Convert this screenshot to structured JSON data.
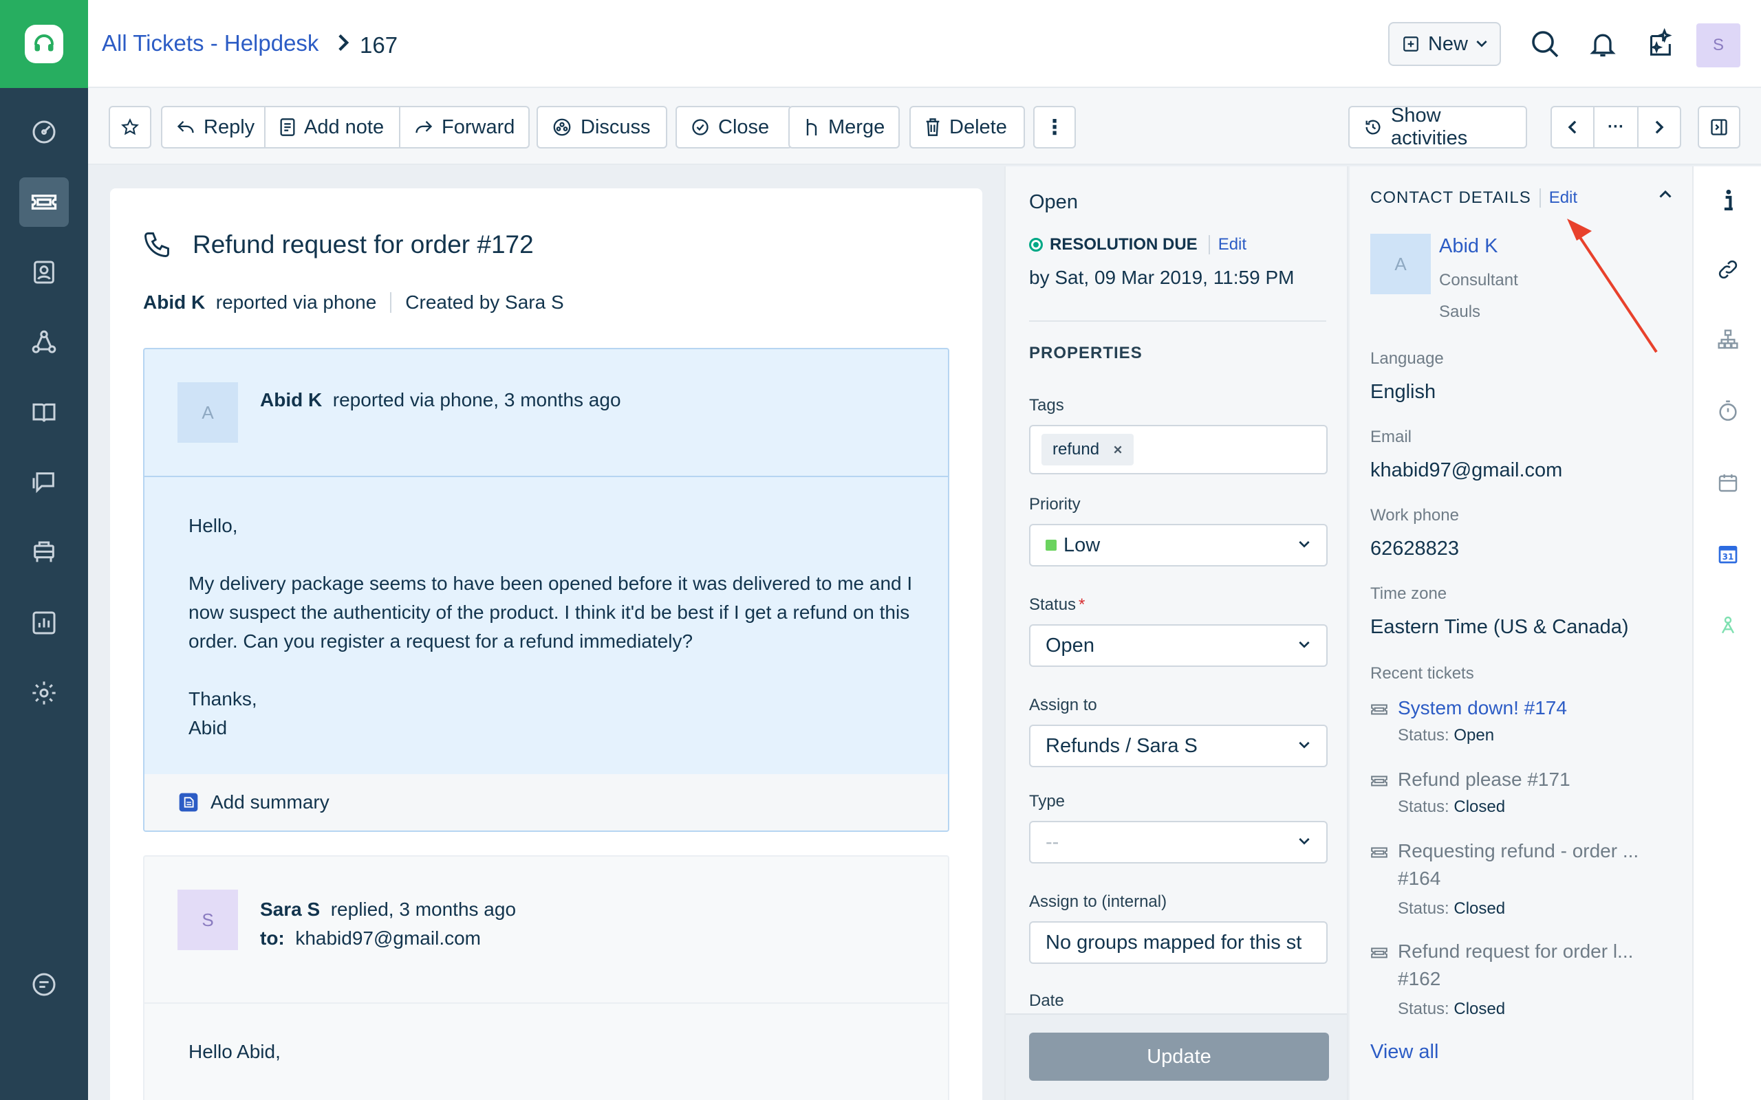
{
  "header": {
    "breadcrumb_link": "All Tickets - Helpdesk",
    "ticket_id": "167",
    "new_label": "New",
    "avatar_initial": "S"
  },
  "toolbar": {
    "reply": "Reply",
    "add_note": "Add note",
    "forward": "Forward",
    "discuss": "Discuss",
    "close": "Close",
    "merge": "Merge",
    "delete": "Delete",
    "show_activities": "Show activities",
    "more": "⋮",
    "pager_more": "···"
  },
  "ticket": {
    "title": "Refund request for order #172",
    "reporter": "Abid K",
    "reported_via": "reported via phone",
    "created_by": "Created by Sara S",
    "messages": [
      {
        "avatar": "A",
        "author": "Abid K",
        "meta": "reported via phone, 3 months ago",
        "greeting": "Hello,",
        "body": "My delivery package seems to have been opened before it was delivered to me and I now suspect the authenticity of the product. I think it'd be best if I get a refund on this order. Can you register a request for a refund immediately?",
        "signoff": "Thanks,",
        "signature": "Abid",
        "summary_label": "Add summary"
      },
      {
        "avatar": "S",
        "author": "Sara S",
        "meta": "replied, 3 months ago",
        "to_label": "to:",
        "to_value": "khabid97@gmail.com",
        "body": "Hello Abid,"
      }
    ]
  },
  "properties": {
    "status_text": "Open",
    "resolution_label": "RESOLUTION DUE",
    "resolution_edit": "Edit",
    "resolution_date": "by Sat, 09 Mar 2019, 11:59 PM",
    "heading": "PROPERTIES",
    "tags_label": "Tags",
    "tags": [
      "refund"
    ],
    "priority_label": "Priority",
    "priority_value": "Low",
    "priority_color": "#6bd35f",
    "status_label": "Status",
    "status_required": "*",
    "status_value": "Open",
    "assign_label": "Assign to",
    "assign_value": "Refunds / Sara S",
    "type_label": "Type",
    "type_value": "--",
    "assign_internal_label": "Assign to (internal)",
    "assign_internal_value": "No groups mapped for this st",
    "date_label": "Date",
    "update_button": "Update"
  },
  "contact": {
    "heading": "CONTACT DETAILS",
    "edit": "Edit",
    "avatar": "A",
    "name": "Abid K",
    "title": "Consultant",
    "company": "Sauls",
    "language_label": "Language",
    "language_value": "English",
    "email_label": "Email",
    "email_value": "khabid97@gmail.com",
    "phone_label": "Work phone",
    "phone_value": "62628823",
    "tz_label": "Time zone",
    "tz_value": "Eastern Time (US & Canada)",
    "recent_label": "Recent tickets",
    "recent_tickets": [
      {
        "title": "System down! #174",
        "status_label": "Status:",
        "status": "Open"
      },
      {
        "title": "Refund please #171",
        "status_label": "Status:",
        "status": "Closed"
      },
      {
        "title": "Requesting refund - order ...",
        "id": "#164",
        "status_label": "Status:",
        "status": "Closed"
      },
      {
        "title": "Refund request for order l...",
        "id": "#162",
        "status_label": "Status:",
        "status": "Closed"
      }
    ],
    "view_all": "View all"
  },
  "rail": {
    "calendar_day": "31"
  },
  "colors": {
    "brand_green": "#27ae60",
    "nav_bg": "#264153",
    "link_blue": "#2c5cc5",
    "annotation_red": "#e8412c"
  }
}
